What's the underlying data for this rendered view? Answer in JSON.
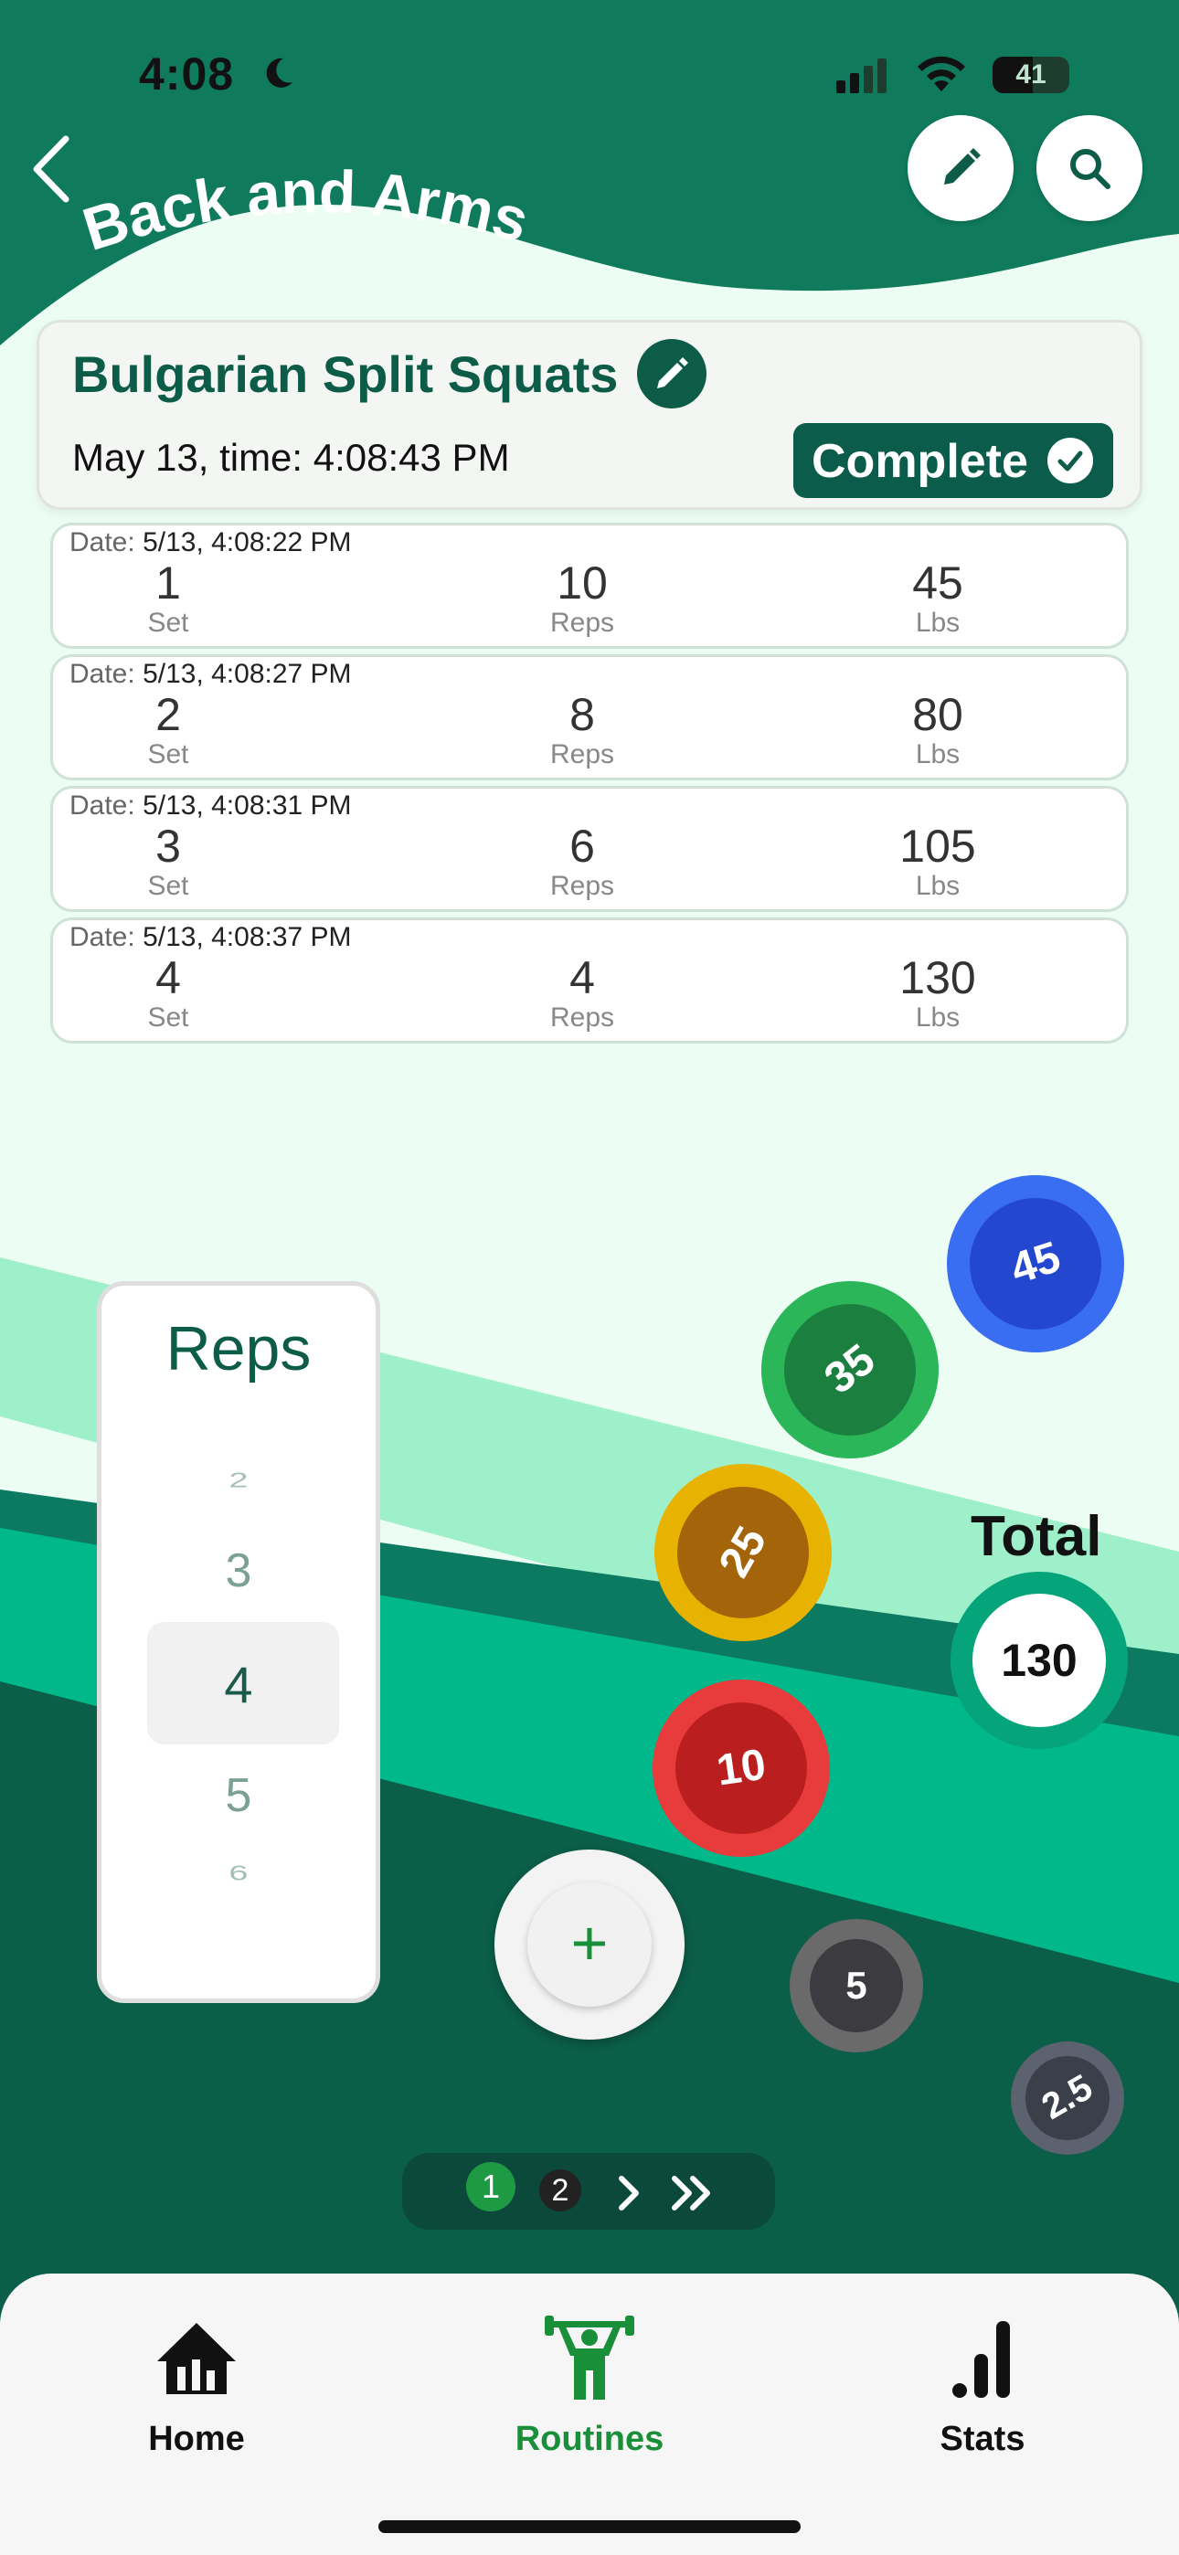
{
  "status_bar": {
    "time": "4:08",
    "battery": "41"
  },
  "header": {
    "title": "Back and Arms"
  },
  "exercise": {
    "name": "Bulgarian Split Squats",
    "time_label": "May 13, time: 4:08:43 PM",
    "complete_label": "Complete"
  },
  "sets": [
    {
      "date_label": "Date:",
      "date": "5/13, 4:08:22 PM",
      "set": "1",
      "reps": "10",
      "weight": "45"
    },
    {
      "date_label": "Date:",
      "date": "5/13, 4:08:27 PM",
      "set": "2",
      "reps": "8",
      "weight": "80"
    },
    {
      "date_label": "Date:",
      "date": "5/13, 4:08:31 PM",
      "set": "3",
      "reps": "6",
      "weight": "105"
    },
    {
      "date_label": "Date:",
      "date": "5/13, 4:08:37 PM",
      "set": "4",
      "reps": "4",
      "weight": "130"
    }
  ],
  "column_labels": {
    "set": "Set",
    "reps": "Reps",
    "weight": "Lbs"
  },
  "picker": {
    "title": "Reps",
    "values": [
      "2",
      "3",
      "4",
      "5",
      "6"
    ],
    "selected": "4"
  },
  "plates": [
    {
      "label": "45",
      "color": "#2a52d9"
    },
    {
      "label": "35",
      "color": "#1f9a48"
    },
    {
      "label": "25",
      "color": "#d9a400"
    },
    {
      "label": "10",
      "color": "#d62828"
    },
    {
      "label": "5",
      "color": "#4a4a4a"
    },
    {
      "label": "2.5",
      "color": "#3a3f4a"
    }
  ],
  "total": {
    "label": "Total",
    "value": "130"
  },
  "pager": {
    "pages": [
      "1",
      "2"
    ],
    "current": "1"
  },
  "tabs": [
    {
      "label": "Home",
      "icon": "home-icon",
      "active": false
    },
    {
      "label": "Routines",
      "icon": "weightlifter-icon",
      "active": true
    },
    {
      "label": "Stats",
      "icon": "stats-bars-icon",
      "active": false
    }
  ],
  "colors": {
    "primary": "#0d5c47",
    "accent_green": "#1a8f3a",
    "header_green": "#11785a"
  }
}
